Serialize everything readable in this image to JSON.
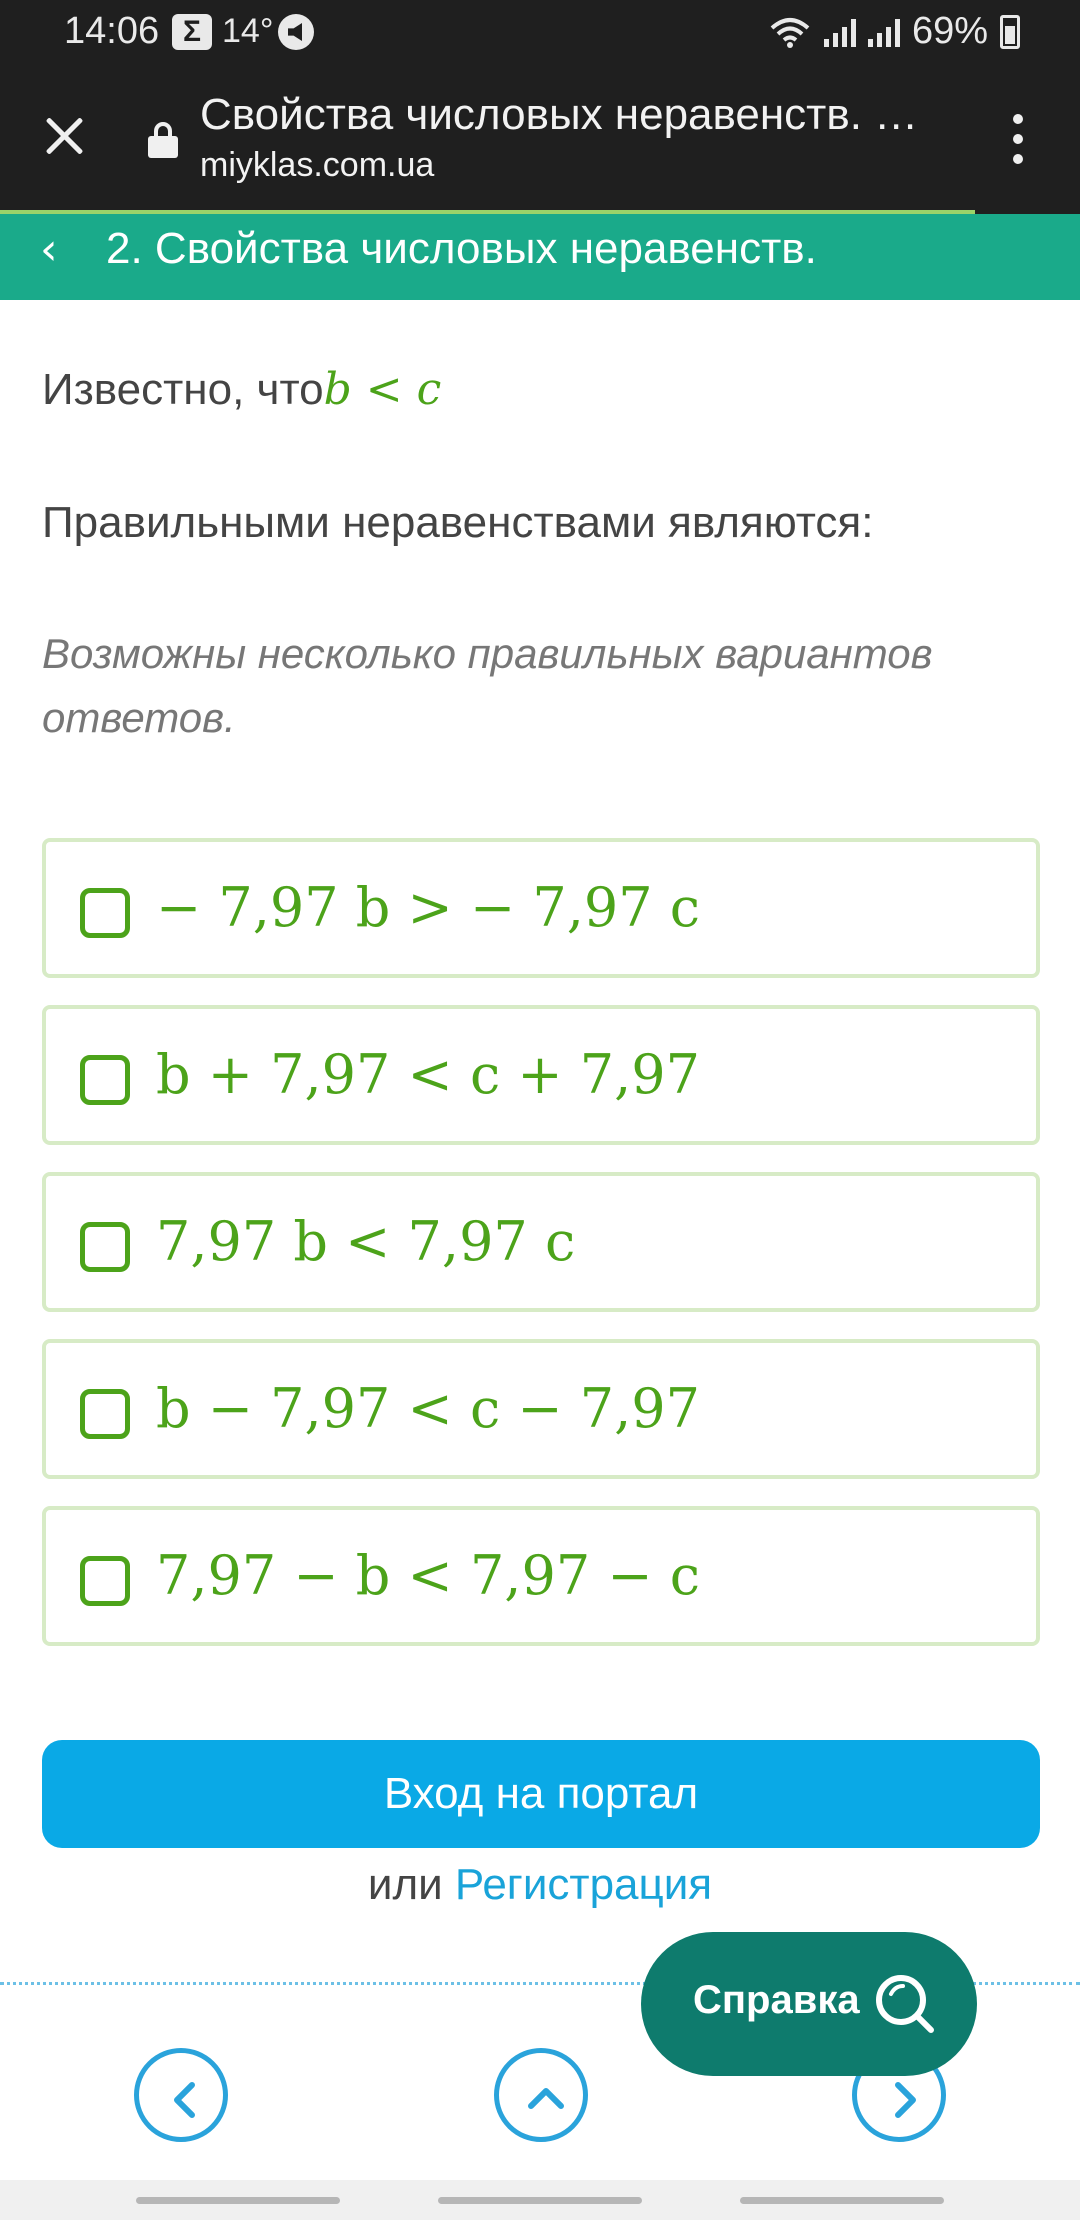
{
  "status_bar": {
    "time": "14:06",
    "sigma": "Σ",
    "temperature": "14°",
    "battery": "69%"
  },
  "browser": {
    "title": "Свойства числовых неравенств. …",
    "url": "miyklas.com.ua"
  },
  "section": {
    "back_icon": "‹",
    "title": "2. Свойства числовых неравенств."
  },
  "question": {
    "known_prefix": "Известно, что",
    "known_b": "b",
    "known_op": "<",
    "known_c": "c",
    "prompt": "Правильными неравенствами являются:",
    "hint": "Возможны несколько правильных вариантов ответов."
  },
  "options": [
    {
      "text": "− 7,97 b > − 7,97 c",
      "checked": false
    },
    {
      "text": "b + 7,97 < c + 7,97",
      "checked": false
    },
    {
      "text": "7,97 b < 7,97 c",
      "checked": false
    },
    {
      "text": "b − 7,97 < c − 7,97",
      "checked": false
    },
    {
      "text": "7,97 − b < 7,97 − c",
      "checked": false
    }
  ],
  "login_button": "Вход на портал",
  "or_text": "или ",
  "register_link": "Регистрация",
  "help_button": "Справка",
  "colors": {
    "accent_green": "#4ca31a",
    "header_teal": "#1aaa8a",
    "login_blue": "#0aa9e6",
    "help_dark_teal": "#0e7b6d"
  }
}
